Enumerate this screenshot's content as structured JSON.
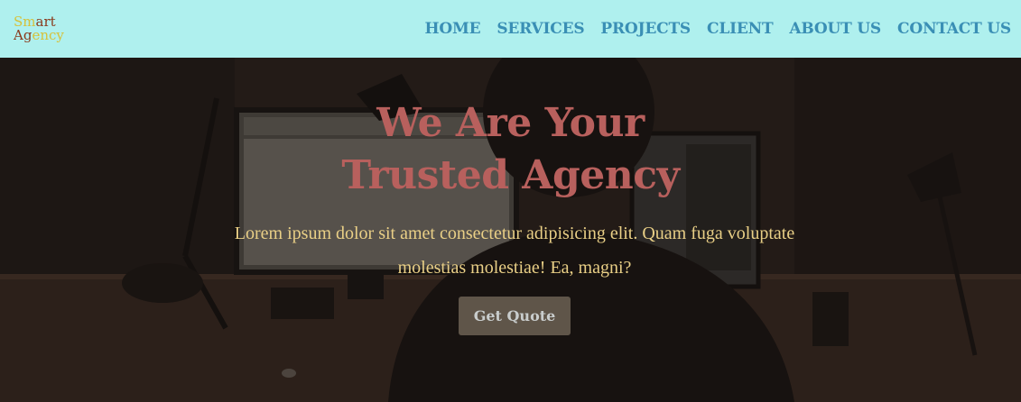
{
  "logo": {
    "line1_a": "Sm",
    "line1_b": "art",
    "line2_a": "Ag",
    "line2_b": "ency"
  },
  "nav": {
    "items": [
      {
        "label": "HOME"
      },
      {
        "label": "SERVICES"
      },
      {
        "label": "PROJECTS"
      },
      {
        "label": "CLIENT"
      },
      {
        "label": "ABOUT US"
      },
      {
        "label": "CONTACT US"
      }
    ]
  },
  "hero": {
    "title_line1": "We Are Your",
    "title_line2": "Trusted Agency",
    "subtitle": "Lorem ipsum dolor sit amet consectetur adipisicing elit. Quam fuga voluptate molestias molestiae! Ea, magni?",
    "cta_label": "Get Quote"
  },
  "colors": {
    "header_bg": "#aff0ee",
    "nav_link": "#3a8fb5",
    "hero_title": "#b8605d",
    "hero_subtitle": "#e9cf86",
    "cta_bg": "#5f5549"
  }
}
